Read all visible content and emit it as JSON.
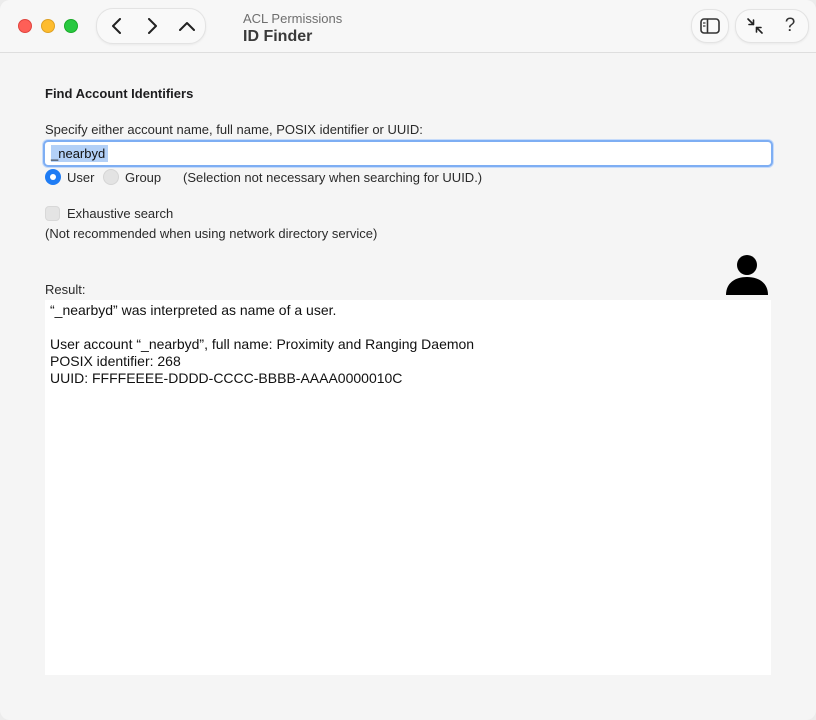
{
  "window": {
    "subtitle": "ACL Permissions",
    "title": "ID Finder"
  },
  "toolbar": {
    "help_label": "?"
  },
  "form": {
    "section_title": "Find Account Identifiers",
    "search_label": "Specify either account name, full name, POSIX identifier or UUID:",
    "search_value": "_nearbyd",
    "type_options": [
      {
        "label": "User",
        "selected": true
      },
      {
        "label": "Group",
        "selected": false
      }
    ],
    "type_note": "(Selection not necessary when searching for UUID.)",
    "exhaustive_label": "Exhaustive search",
    "exhaustive_checked": false,
    "exhaustive_note": "(Not recommended when using network directory service)"
  },
  "result": {
    "label": "Result:",
    "lines": [
      "“_nearbyd” was interpreted as name of a user.",
      "",
      "User account “_nearbyd”, full name: Proximity and Ranging Daemon",
      "POSIX identifier: 268",
      "UUID: FFFFEEEE-DDDD-CCCC-BBBB-AAAA0000010C"
    ]
  },
  "icons": {
    "back": "chevron-left-icon",
    "forward": "chevron-right-icon",
    "up": "chevron-up-icon",
    "sidebar": "sidebar-icon",
    "collapse": "collapse-arrows-icon",
    "result_type": "user-silhouette-icon"
  },
  "colors": {
    "accent": "#1f7cf4",
    "close": "#fe5f57",
    "minimize": "#febc2e",
    "maximize": "#28c840"
  }
}
